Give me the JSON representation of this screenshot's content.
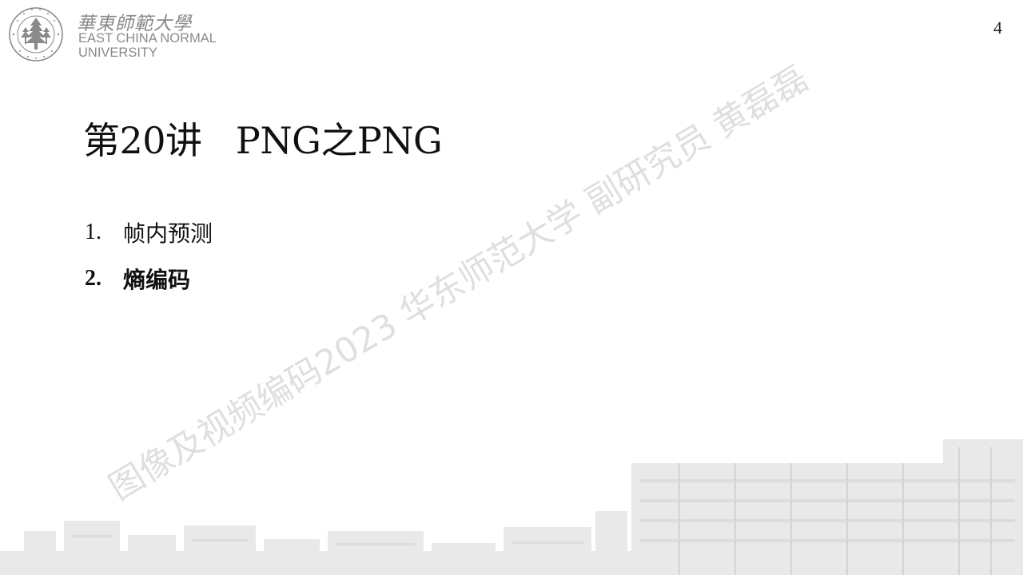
{
  "header": {
    "logo_chinese": "華東師範大學",
    "logo_english_line1": "EAST CHINA NORMAL",
    "logo_english_line2": "UNIVERSITY",
    "seal_ring_text": "EAST CHINA NORMAL UNIVERSITY",
    "seal_bottom_text": "華東師範大學"
  },
  "page_number": "4",
  "title": "第20讲   PNG之PNG",
  "outline": [
    {
      "number": "1.",
      "label": "帧内预测",
      "current": false
    },
    {
      "number": "2.",
      "label": "熵编码",
      "current": true
    }
  ],
  "watermark": "图像及视频编码2023 华东师范大学 副研究员 黄磊磊",
  "colors": {
    "logo_gray": "#8a8a8a",
    "text": "#111111",
    "watermark": "#969696"
  }
}
